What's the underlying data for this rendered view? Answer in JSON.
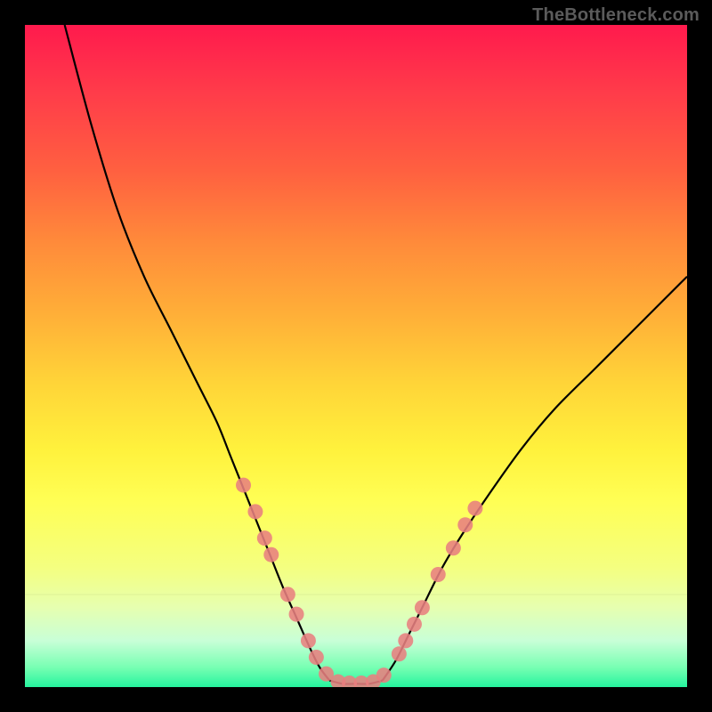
{
  "watermark": "TheBottleneck.com",
  "chart_data": {
    "type": "line",
    "title": "",
    "xlabel": "",
    "ylabel": "",
    "xlim": [
      0,
      100
    ],
    "ylim": [
      0,
      100
    ],
    "grid": false,
    "legend": false,
    "curves": [
      {
        "name": "left-curve",
        "x": [
          6,
          10,
          14,
          18,
          22,
          26,
          29,
          31,
          33,
          35,
          37,
          39,
          41,
          43,
          44.5,
          46
        ],
        "y": [
          100,
          85,
          72,
          62,
          54,
          46,
          40,
          35,
          30,
          25,
          20,
          15,
          10.5,
          6,
          3,
          1
        ]
      },
      {
        "name": "bottom-flat",
        "x": [
          46,
          48,
          50,
          52,
          54
        ],
        "y": [
          1,
          0.5,
          0.5,
          0.5,
          1
        ]
      },
      {
        "name": "right-curve",
        "x": [
          54,
          56,
          58,
          60,
          63,
          66,
          70,
          75,
          80,
          86,
          92,
          100
        ],
        "y": [
          1,
          4,
          8,
          12,
          18,
          23,
          29,
          36,
          42,
          48,
          54,
          62
        ]
      }
    ],
    "markers": {
      "name": "highlight-dots",
      "points": [
        {
          "x": 33.0,
          "y": 30.5
        },
        {
          "x": 34.8,
          "y": 26.5
        },
        {
          "x": 36.2,
          "y": 22.5
        },
        {
          "x": 37.2,
          "y": 20.0
        },
        {
          "x": 39.7,
          "y": 14.0
        },
        {
          "x": 41.0,
          "y": 11.0
        },
        {
          "x": 42.8,
          "y": 7.0
        },
        {
          "x": 44.0,
          "y": 4.5
        },
        {
          "x": 45.5,
          "y": 2.0
        },
        {
          "x": 47.3,
          "y": 0.8
        },
        {
          "x": 49.0,
          "y": 0.6
        },
        {
          "x": 50.8,
          "y": 0.6
        },
        {
          "x": 52.6,
          "y": 0.8
        },
        {
          "x": 54.2,
          "y": 1.8
        },
        {
          "x": 56.5,
          "y": 5.0
        },
        {
          "x": 57.5,
          "y": 7.0
        },
        {
          "x": 58.8,
          "y": 9.5
        },
        {
          "x": 60.0,
          "y": 12.0
        },
        {
          "x": 62.4,
          "y": 17.0
        },
        {
          "x": 64.7,
          "y": 21.0
        },
        {
          "x": 66.5,
          "y": 24.5
        },
        {
          "x": 68.0,
          "y": 27.0
        }
      ]
    }
  }
}
